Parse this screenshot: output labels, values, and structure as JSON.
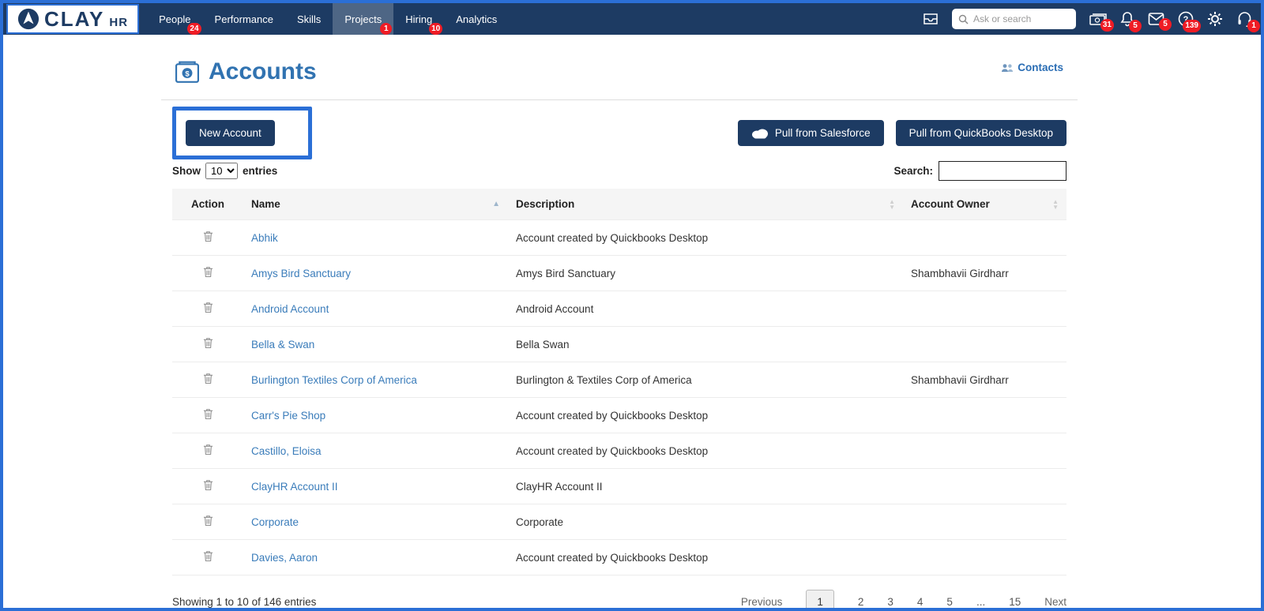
{
  "colors": {
    "accent_blue": "#2b6fd6",
    "navy": "#1d3b63",
    "badge_red": "#ef1c25",
    "title_blue": "#3173b1",
    "link_blue": "#3a7cba"
  },
  "nav": {
    "brand": {
      "name": "CLAY",
      "suffix": "HR"
    },
    "items": [
      {
        "label": "People",
        "badge": "24"
      },
      {
        "label": "Performance"
      },
      {
        "label": "Skills"
      },
      {
        "label": "Projects",
        "badge": "1"
      },
      {
        "label": "Hiring",
        "badge": "10"
      },
      {
        "label": "Analytics"
      }
    ],
    "search": {
      "placeholder": "Ask or search"
    },
    "badges": {
      "money": "31",
      "bell": "5",
      "mail": "5",
      "help": "139",
      "headset": "1"
    }
  },
  "page": {
    "title": "Accounts",
    "contacts_link": "Contacts",
    "new_account": "New Account",
    "pull_salesforce": "Pull from Salesforce",
    "pull_quickbooks": "Pull from QuickBooks Desktop",
    "show_label": "Show",
    "show_value": "10",
    "entries_label": "entries",
    "search_label": "Search:"
  },
  "table": {
    "headers": {
      "action": "Action",
      "name": "Name",
      "description": "Description",
      "owner": "Account Owner"
    },
    "rows": [
      {
        "name": "Abhik",
        "description": "Account created by Quickbooks Desktop",
        "owner": ""
      },
      {
        "name": "Amys Bird Sanctuary",
        "description": "Amys Bird Sanctuary",
        "owner": "Shambhavii Girdharr"
      },
      {
        "name": "Android Account",
        "description": "Android Account",
        "owner": ""
      },
      {
        "name": "Bella & Swan",
        "description": "Bella Swan",
        "owner": ""
      },
      {
        "name": "Burlington Textiles Corp of America",
        "description": "Burlington & Textiles Corp of America",
        "owner": "Shambhavii Girdharr"
      },
      {
        "name": "Carr's Pie Shop",
        "description": "Account created by Quickbooks Desktop",
        "owner": ""
      },
      {
        "name": "Castillo, Eloisa",
        "description": "Account created by Quickbooks Desktop",
        "owner": ""
      },
      {
        "name": "ClayHR Account II",
        "description": "ClayHR Account II",
        "owner": ""
      },
      {
        "name": "Corporate",
        "description": "Corporate",
        "owner": ""
      },
      {
        "name": "Davies, Aaron",
        "description": "Account created by Quickbooks Desktop",
        "owner": ""
      }
    ],
    "summary": "Showing 1 to 10 of 146 entries"
  },
  "pagination": {
    "previous": "Previous",
    "pages": [
      "1",
      "2",
      "3",
      "4",
      "5",
      "...",
      "15"
    ],
    "next": "Next"
  }
}
